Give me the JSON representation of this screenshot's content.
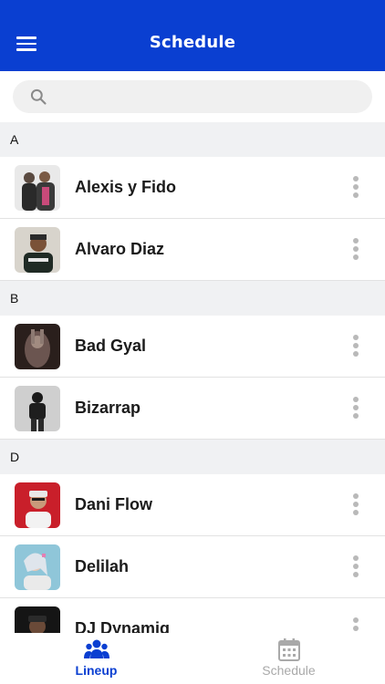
{
  "appbar": {
    "title": "Schedule",
    "menu_icon": "hamburger-menu-icon"
  },
  "search": {
    "placeholder": "",
    "value": "",
    "icon": "search-icon"
  },
  "sections": [
    {
      "letter": "A",
      "artists": [
        {
          "name": "Alexis y Fido"
        },
        {
          "name": "Alvaro Diaz"
        }
      ]
    },
    {
      "letter": "B",
      "artists": [
        {
          "name": "Bad Gyal"
        },
        {
          "name": "Bizarrap"
        }
      ]
    },
    {
      "letter": "D",
      "artists": [
        {
          "name": "Dani Flow"
        },
        {
          "name": "Delilah"
        },
        {
          "name": "DJ Dynamiq"
        }
      ]
    }
  ],
  "tabs": [
    {
      "label": "Lineup",
      "icon": "people-group-icon",
      "active": true,
      "color": "#0a3fd1"
    },
    {
      "label": "Schedule",
      "icon": "calendar-icon",
      "active": false,
      "color": "#a9a9a9"
    }
  ],
  "colors": {
    "primary": "#0a3fd1",
    "section_bg": "#f0f1f3",
    "more_dots": "#b9b9b9"
  }
}
